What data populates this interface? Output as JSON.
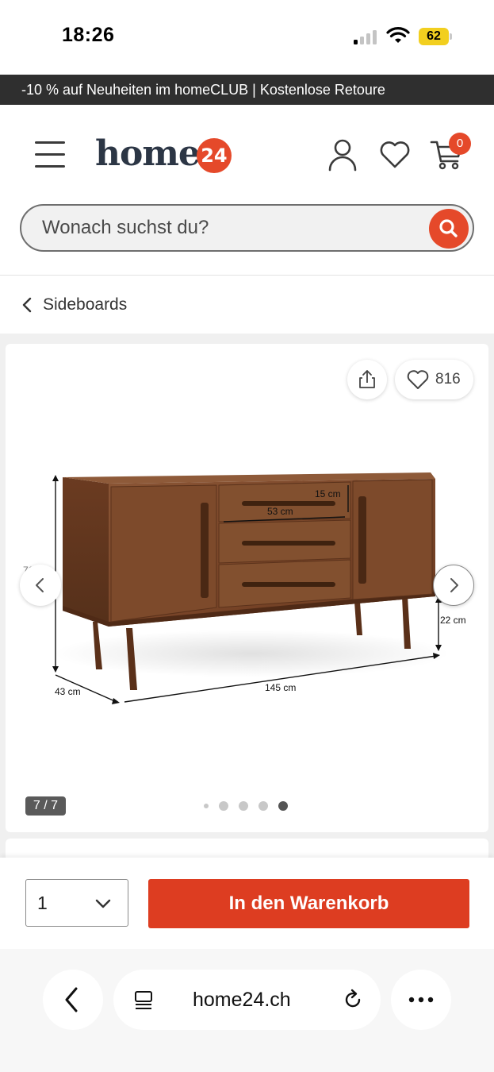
{
  "status_bar": {
    "time": "18:26",
    "battery": "62"
  },
  "promo": {
    "text": "-10 % auf Neuheiten im homeCLUB | Kostenlose Retoure"
  },
  "header": {
    "logo_text": "home",
    "logo_badge": "24",
    "cart_count": "0"
  },
  "search": {
    "placeholder": "Wonach suchst du?"
  },
  "breadcrumb": {
    "label": "Sideboards"
  },
  "gallery": {
    "wishlist_count": "816",
    "image_counter": "7 / 7",
    "dot_count": 5,
    "active_dot": 5,
    "dimensions": {
      "drawer_height": "15 cm",
      "drawer_width": "53 cm",
      "height": "71 cm",
      "leg_height": "22 cm",
      "depth": "43 cm",
      "width": "145 cm"
    }
  },
  "buy": {
    "quantity": "1",
    "cart_button": "In den Warenkorb"
  },
  "browser": {
    "url": "home24.ch"
  },
  "colors": {
    "brand": "#e5492a",
    "cta": "#dd3d21",
    "promo_bg": "#2f2f2f",
    "wood": "#7a4a2c"
  }
}
